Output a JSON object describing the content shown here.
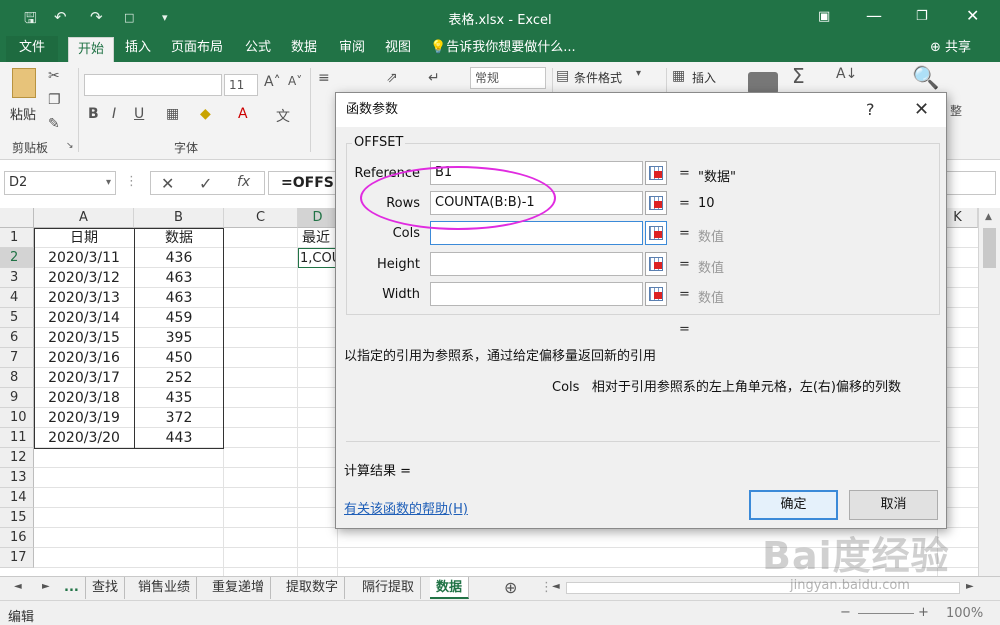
{
  "titlebar": {
    "title": "表格.xlsx - Excel"
  },
  "tabs": [
    {
      "label": "文件"
    },
    {
      "label": "开始"
    },
    {
      "label": "插入"
    },
    {
      "label": "页面布局"
    },
    {
      "label": "公式"
    },
    {
      "label": "数据"
    },
    {
      "label": "审阅"
    },
    {
      "label": "视图"
    }
  ],
  "tellme": "告诉我你想要做什么...",
  "share": "共享",
  "ribbon": {
    "paste": "粘贴",
    "clipboard_label": "剪贴板",
    "font_label": "字体",
    "font_size": "11",
    "number_format": "常规",
    "conditional_format": "条件格式",
    "insert": "插入"
  },
  "formula_bar": {
    "name_box": "D2",
    "formula": "=OFFSE"
  },
  "columns": [
    "A",
    "B",
    "C",
    "D",
    "K"
  ],
  "rows": [
    "1",
    "2",
    "3",
    "4",
    "5",
    "6",
    "7",
    "8",
    "9",
    "10",
    "11",
    "12",
    "13",
    "14",
    "15",
    "16",
    "17"
  ],
  "table": {
    "headers": [
      "日期",
      "数据"
    ],
    "data": [
      [
        "2020/3/11",
        "436"
      ],
      [
        "2020/3/12",
        "463"
      ],
      [
        "2020/3/13",
        "463"
      ],
      [
        "2020/3/14",
        "459"
      ],
      [
        "2020/3/15",
        "395"
      ],
      [
        "2020/3/16",
        "450"
      ],
      [
        "2020/3/17",
        "252"
      ],
      [
        "2020/3/18",
        "435"
      ],
      [
        "2020/3/19",
        "372"
      ],
      [
        "2020/3/20",
        "443"
      ]
    ]
  },
  "d1": "最近",
  "d2": "1,COU",
  "sheets": [
    "...",
    "查找",
    "销售业绩",
    "重复递增",
    "提取数字",
    "隔行提取",
    "数据"
  ],
  "status": {
    "mode": "编辑",
    "zoom": "100%"
  },
  "dialog": {
    "title": "函数参数",
    "help_glyph": "?",
    "close_glyph": "✕",
    "function_name": "OFFSET",
    "args": [
      {
        "label": "Reference",
        "value": "B1",
        "result": "\"数据\"",
        "grey": false
      },
      {
        "label": "Rows",
        "value": "COUNTA(B:B)-1",
        "result": "10",
        "grey": false
      },
      {
        "label": "Cols",
        "value": "",
        "result": "数值",
        "grey": true
      },
      {
        "label": "Height",
        "value": "",
        "result": "数值",
        "grey": true
      },
      {
        "label": "Width",
        "value": "",
        "result": "数值",
        "grey": true
      }
    ],
    "equals": "=",
    "description": "以指定的引用为参照系，通过给定偏移量返回新的引用",
    "arg_name": "Cols",
    "arg_description": "相对于引用参照系的左上角单元格，左(右)偏移的列数",
    "calc_result": "计算结果 =",
    "help_link": "有关该函数的帮助(H)",
    "ok": "确定",
    "cancel": "取消"
  },
  "watermark": {
    "logo": "Bai度经验",
    "url": "jingyan.baidu.com"
  },
  "colors": {
    "excel_green": "#217346",
    "highlight": "#e02be0",
    "link": "#1f5fb8"
  }
}
